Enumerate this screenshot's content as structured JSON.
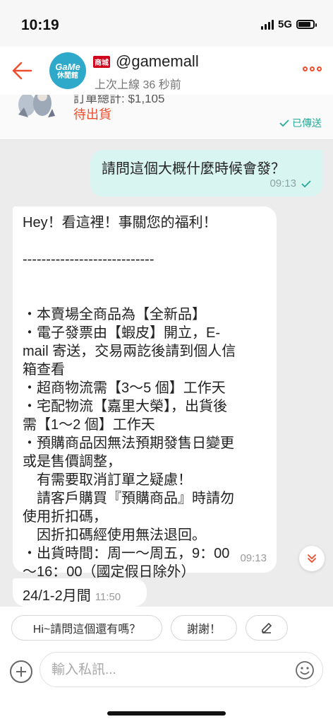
{
  "status_bar": {
    "time": "10:19",
    "network": "5G",
    "battery_level": 0.85
  },
  "header": {
    "avatar_text_1": "GaMe",
    "avatar_text_2": "休閒館",
    "mall_badge": "商城",
    "shop_name": "@gamemall",
    "last_seen": "上次上線 36 秒前",
    "icons": [
      "back-arrow-icon",
      "more-dots-icon"
    ]
  },
  "order_card": {
    "total": "訂單總計: $1,105",
    "status": "待出貨",
    "sent_label": "已傳送"
  },
  "messages": {
    "outgoing": {
      "text": "請問這個大概什麼時候會發？",
      "time": "09:13"
    },
    "incoming": {
      "lines": [
        "Hey！看這裡！事關您的福利！",
        "",
        "----------------------------",
        "",
        "",
        "・本賣場全商品為【全新品】",
        "・電子發票由【蝦皮】開立，E-",
        "mail 寄送，交易兩訖後請到個人信",
        "箱查看",
        "・超商物流需【3～5 個】工作天",
        "・宅配物流【嘉里大榮】，出貨後",
        "需【1～2 個】工作天",
        "・預購商品因無法預期發售日變更",
        "或是售價調整，",
        "　有需要取消訂單之疑慮！",
        "　請客戶購買『預購商品』時請勿",
        "使用折扣碼，",
        "　因折扣碼經使用無法退回。",
        "・出貨時間：周一～周五，9：00",
        "～16：00（國定假日除外）"
      ],
      "time": "09:13"
    },
    "incoming_small": {
      "text": "24/1-2月間",
      "time": "11:50"
    }
  },
  "quick_replies": [
    "Hi~請問這個還有嗎？",
    "謝謝！"
  ],
  "input": {
    "placeholder": "輸入私訊..."
  },
  "colors": {
    "accent": "#ee4d2d",
    "sent_bubble": "#d9f5f1",
    "sent_check": "#26aa99"
  }
}
